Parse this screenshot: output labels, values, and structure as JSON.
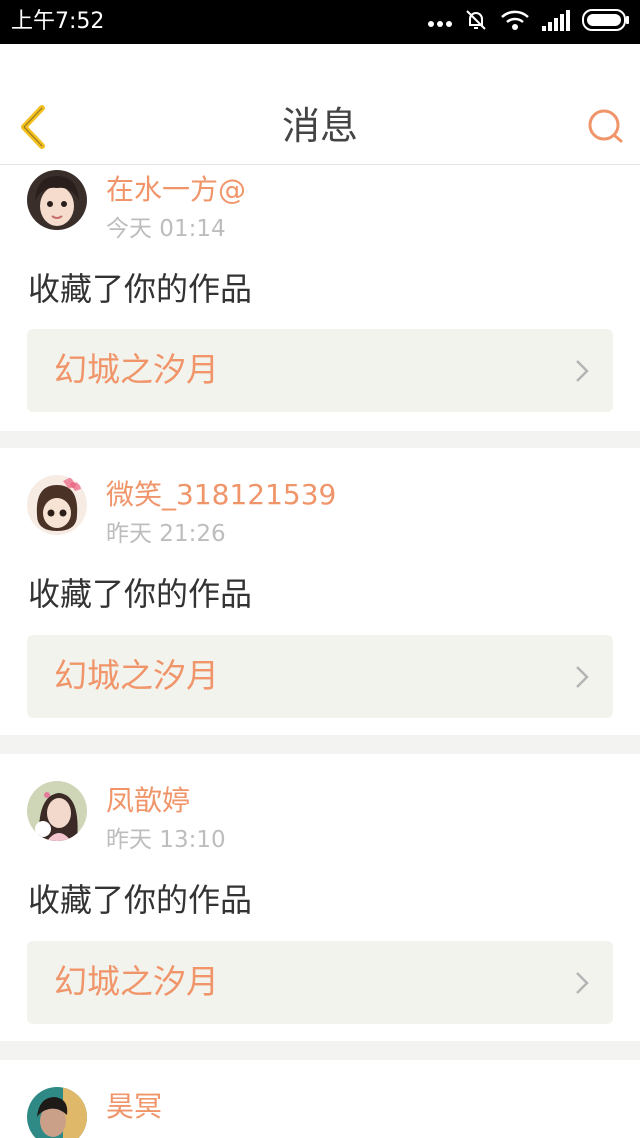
{
  "status_bar": {
    "time": "上午7:52",
    "icons": [
      "more-dots-icon",
      "bell-off-icon",
      "wifi-icon",
      "signal-icon",
      "battery-icon"
    ]
  },
  "header": {
    "title": "消息",
    "back_icon": "chevron-left-icon",
    "search_icon": "search-icon"
  },
  "colors": {
    "accent_orange": "#f0956a",
    "back_yellow": "#f3c020",
    "text_dark": "#333333",
    "text_gray": "#bdbdbd",
    "card_link_bg": "#f3f3ee",
    "separator_bg": "#f3f3f1"
  },
  "messages": [
    {
      "user": "在水一方@",
      "time": "今天 01:14",
      "action": "收藏了你的作品",
      "work": "幻城之汐月"
    },
    {
      "user": "微笑_318121539",
      "time": "昨天 21:26",
      "action": "收藏了你的作品",
      "work": "幻城之汐月"
    },
    {
      "user": "凤歆婷",
      "time": "昨天 13:10",
      "action": "收藏了你的作品",
      "work": "幻城之汐月"
    },
    {
      "user": "昊冥"
    }
  ]
}
